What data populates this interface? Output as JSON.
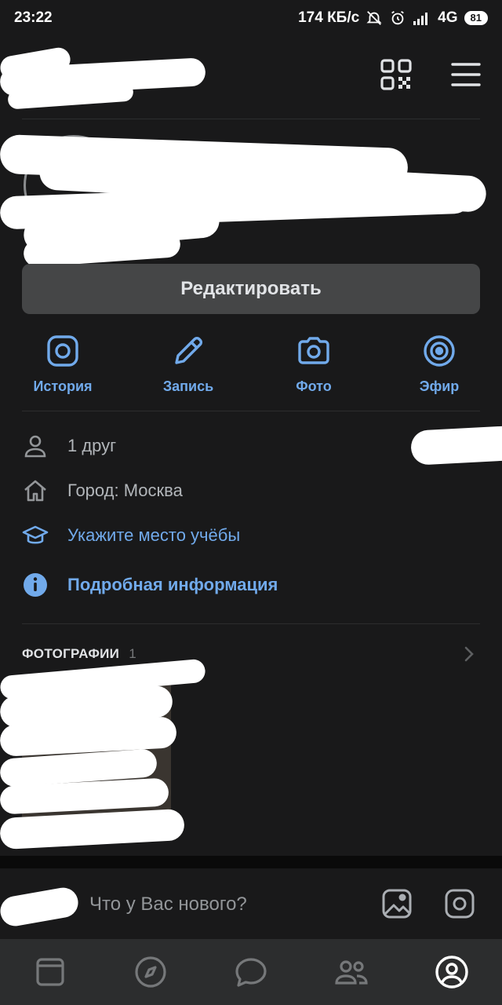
{
  "status_bar": {
    "time": "23:22",
    "speed": "174 КБ/с",
    "network": "4G",
    "battery": "81",
    "icons": [
      "mute-icon",
      "alarm-icon",
      "signal-icon",
      "battery-icon"
    ]
  },
  "top_bar": {
    "icons": [
      "qr-code-icon",
      "hamburger-menu-icon"
    ]
  },
  "profile": {
    "edit_button": "Редактировать"
  },
  "actions": [
    {
      "label": "История",
      "icon": "instagram-story-icon"
    },
    {
      "label": "Запись",
      "icon": "pencil-icon"
    },
    {
      "label": "Фото",
      "icon": "camera-icon"
    },
    {
      "label": "Эфир",
      "icon": "live-broadcast-icon"
    }
  ],
  "info": {
    "friends": "1 друг",
    "city": "Город: Москва",
    "education": "Укажите место учёбы",
    "details": "Подробная информация"
  },
  "photos": {
    "title": "ФОТОГРАФИИ",
    "count": "1"
  },
  "composer": {
    "placeholder": "Что у Вас нового?"
  },
  "tab_bar": {
    "tabs": [
      "news-icon",
      "explore-compass-icon",
      "messages-icon",
      "friends-icon",
      "profile-icon"
    ],
    "active": "profile-icon"
  },
  "colors": {
    "background": "#19191a",
    "accent": "#71aaeb",
    "button": "#454647",
    "tabbar": "#2c2d2e",
    "info_icon": "#71aaeb"
  }
}
